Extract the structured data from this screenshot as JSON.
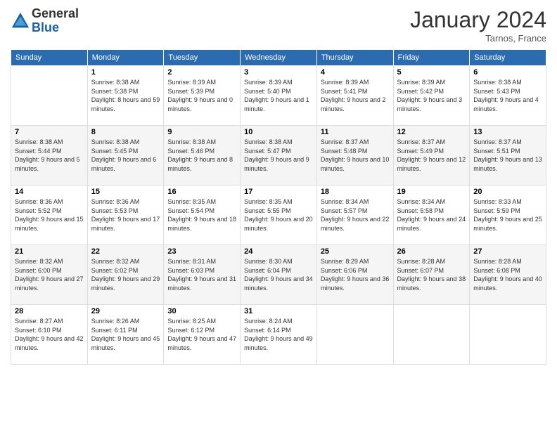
{
  "logo": {
    "general": "General",
    "blue": "Blue"
  },
  "title": "January 2024",
  "location": "Tarnos, France",
  "days_of_week": [
    "Sunday",
    "Monday",
    "Tuesday",
    "Wednesday",
    "Thursday",
    "Friday",
    "Saturday"
  ],
  "weeks": [
    [
      {
        "day": "",
        "sunrise": "",
        "sunset": "",
        "daylight": ""
      },
      {
        "day": "1",
        "sunrise": "Sunrise: 8:38 AM",
        "sunset": "Sunset: 5:38 PM",
        "daylight": "Daylight: 8 hours and 59 minutes."
      },
      {
        "day": "2",
        "sunrise": "Sunrise: 8:39 AM",
        "sunset": "Sunset: 5:39 PM",
        "daylight": "Daylight: 9 hours and 0 minutes."
      },
      {
        "day": "3",
        "sunrise": "Sunrise: 8:39 AM",
        "sunset": "Sunset: 5:40 PM",
        "daylight": "Daylight: 9 hours and 1 minute."
      },
      {
        "day": "4",
        "sunrise": "Sunrise: 8:39 AM",
        "sunset": "Sunset: 5:41 PM",
        "daylight": "Daylight: 9 hours and 2 minutes."
      },
      {
        "day": "5",
        "sunrise": "Sunrise: 8:39 AM",
        "sunset": "Sunset: 5:42 PM",
        "daylight": "Daylight: 9 hours and 3 minutes."
      },
      {
        "day": "6",
        "sunrise": "Sunrise: 8:38 AM",
        "sunset": "Sunset: 5:43 PM",
        "daylight": "Daylight: 9 hours and 4 minutes."
      }
    ],
    [
      {
        "day": "7",
        "sunrise": "Sunrise: 8:38 AM",
        "sunset": "Sunset: 5:44 PM",
        "daylight": "Daylight: 9 hours and 5 minutes."
      },
      {
        "day": "8",
        "sunrise": "Sunrise: 8:38 AM",
        "sunset": "Sunset: 5:45 PM",
        "daylight": "Daylight: 9 hours and 6 minutes."
      },
      {
        "day": "9",
        "sunrise": "Sunrise: 8:38 AM",
        "sunset": "Sunset: 5:46 PM",
        "daylight": "Daylight: 9 hours and 8 minutes."
      },
      {
        "day": "10",
        "sunrise": "Sunrise: 8:38 AM",
        "sunset": "Sunset: 5:47 PM",
        "daylight": "Daylight: 9 hours and 9 minutes."
      },
      {
        "day": "11",
        "sunrise": "Sunrise: 8:37 AM",
        "sunset": "Sunset: 5:48 PM",
        "daylight": "Daylight: 9 hours and 10 minutes."
      },
      {
        "day": "12",
        "sunrise": "Sunrise: 8:37 AM",
        "sunset": "Sunset: 5:49 PM",
        "daylight": "Daylight: 9 hours and 12 minutes."
      },
      {
        "day": "13",
        "sunrise": "Sunrise: 8:37 AM",
        "sunset": "Sunset: 5:51 PM",
        "daylight": "Daylight: 9 hours and 13 minutes."
      }
    ],
    [
      {
        "day": "14",
        "sunrise": "Sunrise: 8:36 AM",
        "sunset": "Sunset: 5:52 PM",
        "daylight": "Daylight: 9 hours and 15 minutes."
      },
      {
        "day": "15",
        "sunrise": "Sunrise: 8:36 AM",
        "sunset": "Sunset: 5:53 PM",
        "daylight": "Daylight: 9 hours and 17 minutes."
      },
      {
        "day": "16",
        "sunrise": "Sunrise: 8:35 AM",
        "sunset": "Sunset: 5:54 PM",
        "daylight": "Daylight: 9 hours and 18 minutes."
      },
      {
        "day": "17",
        "sunrise": "Sunrise: 8:35 AM",
        "sunset": "Sunset: 5:55 PM",
        "daylight": "Daylight: 9 hours and 20 minutes."
      },
      {
        "day": "18",
        "sunrise": "Sunrise: 8:34 AM",
        "sunset": "Sunset: 5:57 PM",
        "daylight": "Daylight: 9 hours and 22 minutes."
      },
      {
        "day": "19",
        "sunrise": "Sunrise: 8:34 AM",
        "sunset": "Sunset: 5:58 PM",
        "daylight": "Daylight: 9 hours and 24 minutes."
      },
      {
        "day": "20",
        "sunrise": "Sunrise: 8:33 AM",
        "sunset": "Sunset: 5:59 PM",
        "daylight": "Daylight: 9 hours and 25 minutes."
      }
    ],
    [
      {
        "day": "21",
        "sunrise": "Sunrise: 8:32 AM",
        "sunset": "Sunset: 6:00 PM",
        "daylight": "Daylight: 9 hours and 27 minutes."
      },
      {
        "day": "22",
        "sunrise": "Sunrise: 8:32 AM",
        "sunset": "Sunset: 6:02 PM",
        "daylight": "Daylight: 9 hours and 29 minutes."
      },
      {
        "day": "23",
        "sunrise": "Sunrise: 8:31 AM",
        "sunset": "Sunset: 6:03 PM",
        "daylight": "Daylight: 9 hours and 31 minutes."
      },
      {
        "day": "24",
        "sunrise": "Sunrise: 8:30 AM",
        "sunset": "Sunset: 6:04 PM",
        "daylight": "Daylight: 9 hours and 34 minutes."
      },
      {
        "day": "25",
        "sunrise": "Sunrise: 8:29 AM",
        "sunset": "Sunset: 6:06 PM",
        "daylight": "Daylight: 9 hours and 36 minutes."
      },
      {
        "day": "26",
        "sunrise": "Sunrise: 8:28 AM",
        "sunset": "Sunset: 6:07 PM",
        "daylight": "Daylight: 9 hours and 38 minutes."
      },
      {
        "day": "27",
        "sunrise": "Sunrise: 8:28 AM",
        "sunset": "Sunset: 6:08 PM",
        "daylight": "Daylight: 9 hours and 40 minutes."
      }
    ],
    [
      {
        "day": "28",
        "sunrise": "Sunrise: 8:27 AM",
        "sunset": "Sunset: 6:10 PM",
        "daylight": "Daylight: 9 hours and 42 minutes."
      },
      {
        "day": "29",
        "sunrise": "Sunrise: 8:26 AM",
        "sunset": "Sunset: 6:11 PM",
        "daylight": "Daylight: 9 hours and 45 minutes."
      },
      {
        "day": "30",
        "sunrise": "Sunrise: 8:25 AM",
        "sunset": "Sunset: 6:12 PM",
        "daylight": "Daylight: 9 hours and 47 minutes."
      },
      {
        "day": "31",
        "sunrise": "Sunrise: 8:24 AM",
        "sunset": "Sunset: 6:14 PM",
        "daylight": "Daylight: 9 hours and 49 minutes."
      },
      {
        "day": "",
        "sunrise": "",
        "sunset": "",
        "daylight": ""
      },
      {
        "day": "",
        "sunrise": "",
        "sunset": "",
        "daylight": ""
      },
      {
        "day": "",
        "sunrise": "",
        "sunset": "",
        "daylight": ""
      }
    ]
  ]
}
